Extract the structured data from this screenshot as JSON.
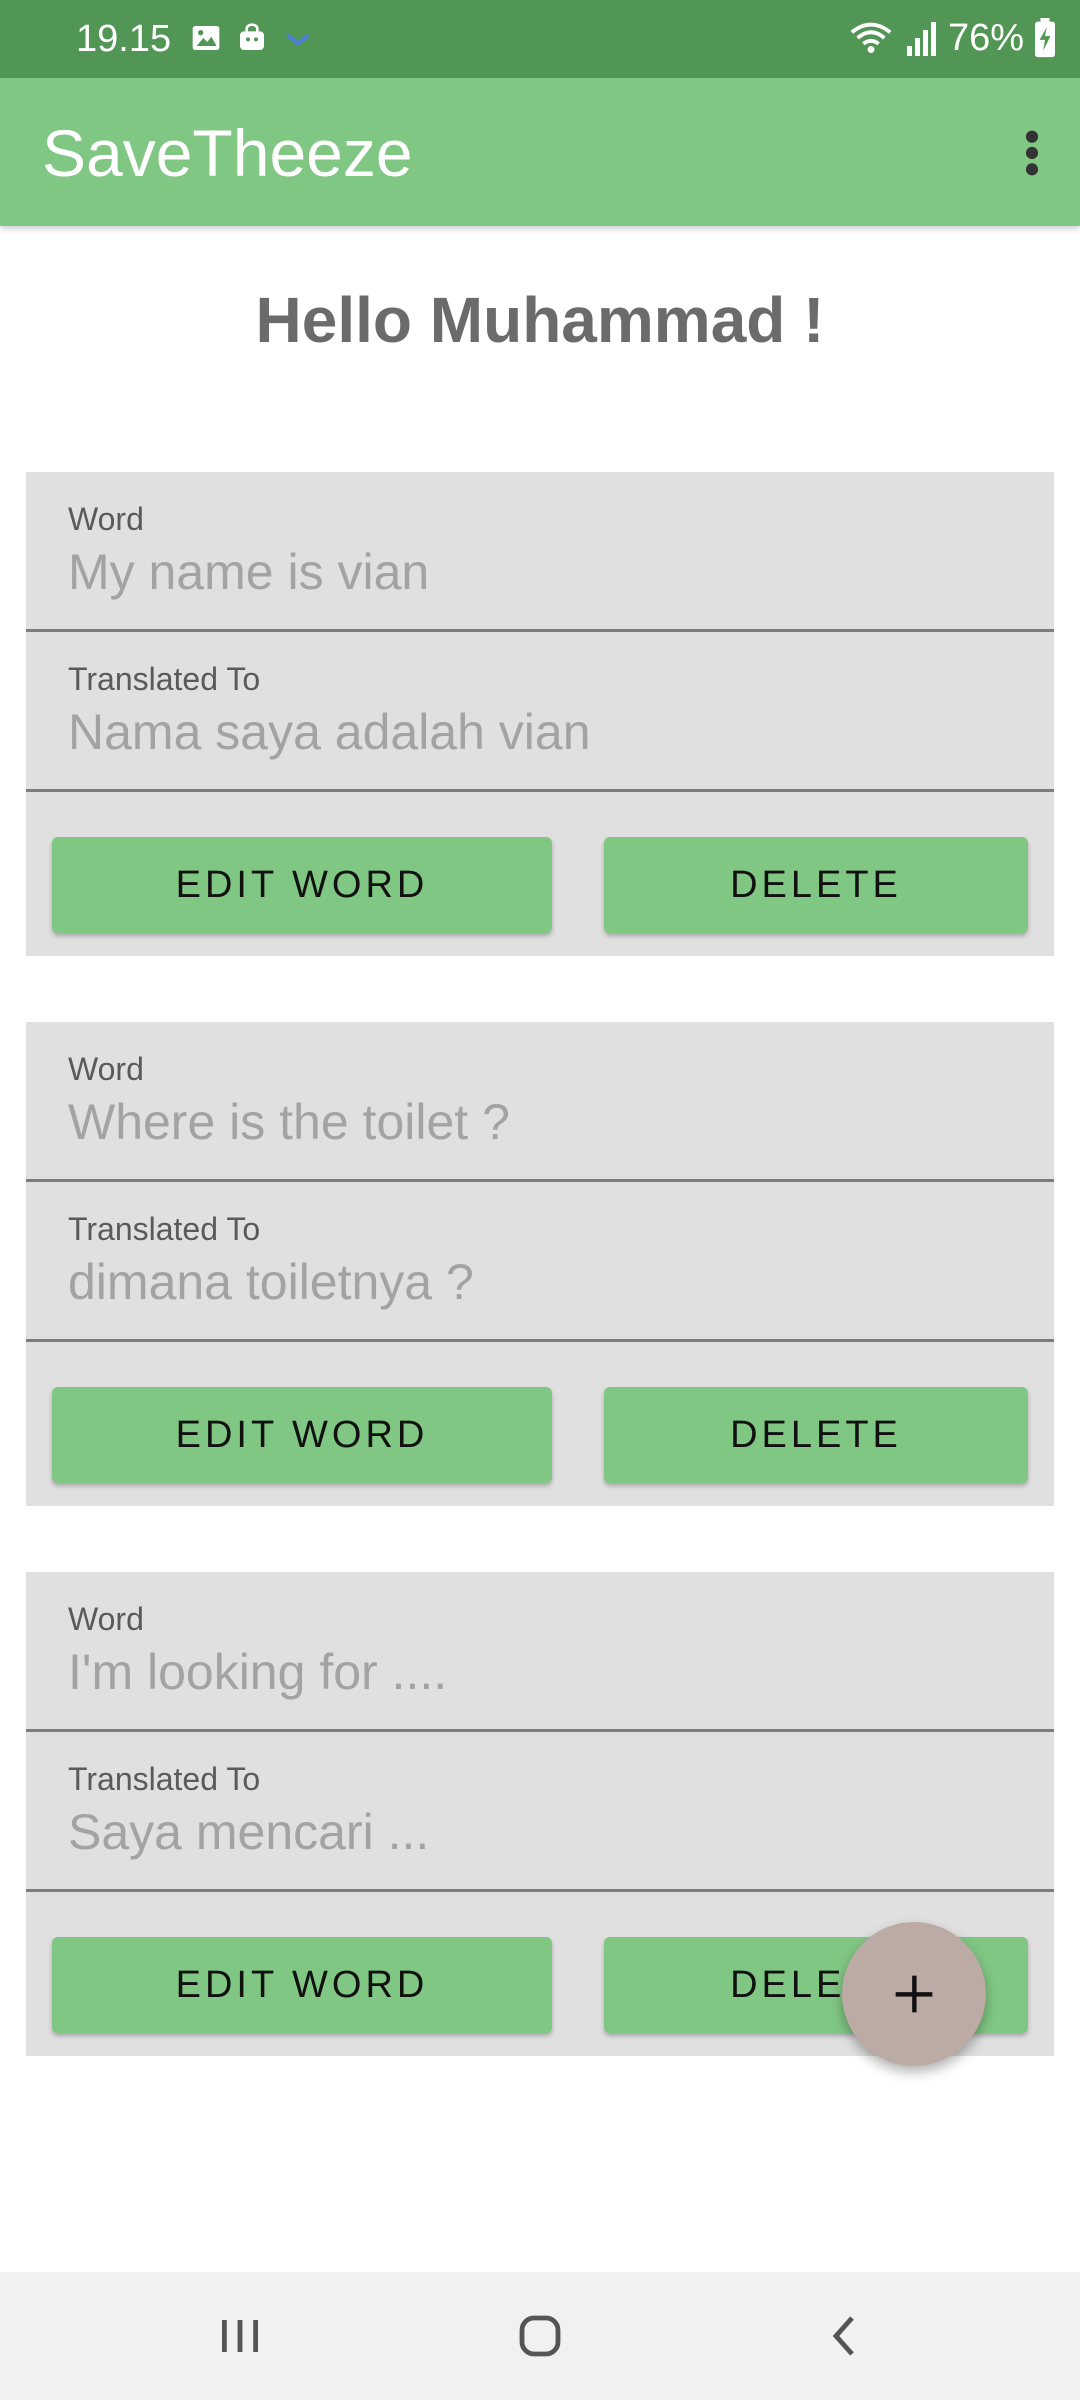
{
  "status_bar": {
    "time": "19.15",
    "battery": "76%",
    "icons": [
      "image-icon",
      "shopping-bag-icon",
      "download-icon",
      "wifi-icon",
      "signal-icon",
      "battery-charging-icon"
    ]
  },
  "app_bar": {
    "title": "SaveTheeze",
    "menu_icon": "more-vert-icon"
  },
  "greeting": "Hello Muhammad !",
  "cards": [
    {
      "word_label": "Word",
      "word": "My name is vian",
      "translated_label": "Translated To",
      "translated": "Nama saya adalah vian",
      "edit_label": "EDIT WORD",
      "delete_label": "DELETE"
    },
    {
      "word_label": "Word",
      "word": "Where is the toilet ?",
      "translated_label": "Translated To",
      "translated": "dimana toiletnya ?",
      "edit_label": "EDIT WORD",
      "delete_label": "DELETE"
    },
    {
      "word_label": "Word",
      "word": "I'm looking for ....",
      "translated_label": "Translated To",
      "translated": "Saya mencari ...",
      "edit_label": "EDIT WORD",
      "delete_label": "DELETE"
    }
  ],
  "fab": {
    "icon": "add-icon"
  },
  "nav_bar": {
    "icons": [
      "recent-apps-icon",
      "home-icon",
      "back-icon"
    ]
  },
  "colors": {
    "status_bar": "#529656",
    "app_bar": "#81c784",
    "card_bg": "#e0e0e0",
    "button": "#81c784",
    "fab": "#bcaaa4"
  }
}
